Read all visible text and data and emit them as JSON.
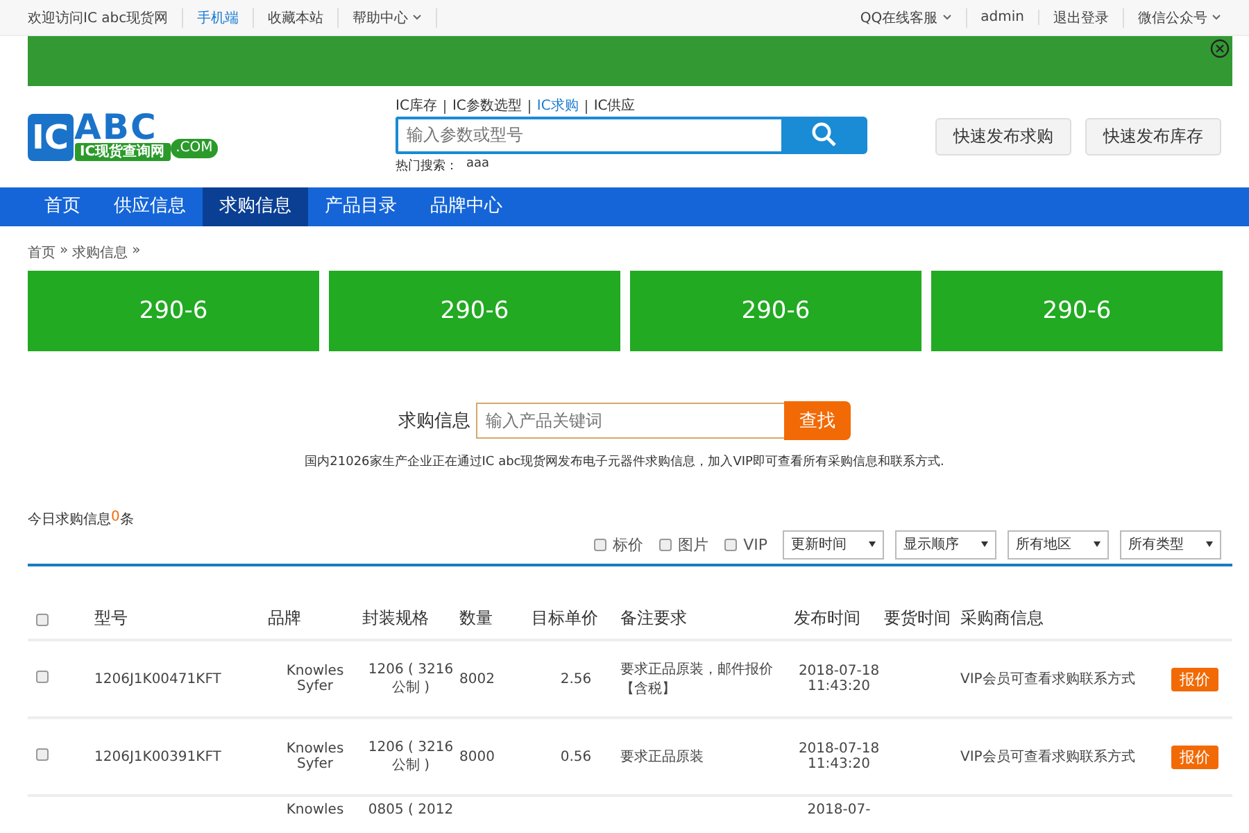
{
  "top_bar": {
    "left": [
      {
        "label": "欢迎访问IC abc现货网",
        "highlighted": false,
        "dropdown": false
      },
      {
        "label": "手机端",
        "highlighted": true,
        "dropdown": false
      },
      {
        "label": "收藏本站",
        "highlighted": false,
        "dropdown": false
      },
      {
        "label": "帮助中心",
        "highlighted": false,
        "dropdown": true
      }
    ],
    "right": [
      {
        "label": "QQ在线客服",
        "highlighted": false,
        "dropdown": true
      },
      {
        "label": "admin",
        "highlighted": false,
        "dropdown": false
      },
      {
        "label": "退出登录",
        "highlighted": false,
        "dropdown": false
      },
      {
        "label": "微信公众号",
        "highlighted": false,
        "dropdown": true
      }
    ]
  },
  "banner": {
    "closable": true
  },
  "header": {
    "logo": {
      "mark": "IC",
      "name": "ABC",
      "slogan": "IC现货查询网",
      "domain": ".COM"
    },
    "search_tabs": [
      {
        "label": "IC库存",
        "selected": false
      },
      {
        "label": "IC参数选型",
        "selected": false
      },
      {
        "label": "IC求购",
        "selected": true
      },
      {
        "label": "IC供应",
        "selected": false
      }
    ],
    "search": {
      "placeholder": "输入参数或型号"
    },
    "hot_label": "热门搜索：",
    "hot_terms": [
      "aaa"
    ],
    "buttons": [
      "快速发布求购",
      "快速发布库存"
    ]
  },
  "nav": [
    {
      "label": "首页",
      "selected": false
    },
    {
      "label": "供应信息",
      "selected": false
    },
    {
      "label": "求购信息",
      "selected": true
    },
    {
      "label": "产品目录",
      "selected": false
    },
    {
      "label": "品牌中心",
      "selected": false
    }
  ],
  "breadcrumb": [
    {
      "label": "首页",
      "separator": "»"
    },
    {
      "label": "求购信息",
      "separator": "»"
    }
  ],
  "tiles": [
    "290-6",
    "290-6",
    "290-6",
    "290-6"
  ],
  "keyword_search": {
    "label": "求购信息",
    "placeholder": "输入产品关键词",
    "button": "查找"
  },
  "notice": "国内21026家生产企业正在通过IC abc现货网发布电子元器件求购信息，加入VIP即可查看所有采购信息和联系方式.",
  "today": {
    "prefix": "今日求购信息",
    "count": "0",
    "suffix": "条"
  },
  "filters": {
    "checkboxes": [
      {
        "label": "标价",
        "checked": false
      },
      {
        "label": "图片",
        "checked": false
      },
      {
        "label": "VIP",
        "checked": false
      }
    ],
    "selects": [
      "更新时间",
      "显示顺序",
      "所有地区",
      "所有类型"
    ]
  },
  "table": {
    "header_checked": false,
    "columns": [
      "型号",
      "品牌",
      "封装规格",
      "数量",
      "目标单价",
      "备注要求",
      "发布时间",
      "要货时间",
      "采购商信息"
    ],
    "rows": [
      {
        "checked": false,
        "model": "1206J1K00471KFT",
        "brand": "Knowles Syfer",
        "package": "1206 ( 3216 公制 )",
        "qty": "8002",
        "price": "2.56",
        "note": "要求正品原装，邮件报价【含税】",
        "posted": "2018-07-18 11:43:20",
        "buyer": "VIP会员可查看求购联系方式",
        "action": "报价"
      },
      {
        "checked": false,
        "model": "1206J1K00391KFT",
        "brand": "Knowles Syfer",
        "package": "1206 ( 3216 公制 )",
        "qty": "8000",
        "price": "0.56",
        "note": "要求正品原装",
        "posted": "2018-07-18 11:43:20",
        "buyer": "VIP会员可查看求购联系方式",
        "action": "报价"
      }
    ],
    "partial_row": {
      "brand": "Knowles",
      "package": "0805 ( 2012",
      "posted": "2018-07-"
    }
  }
}
